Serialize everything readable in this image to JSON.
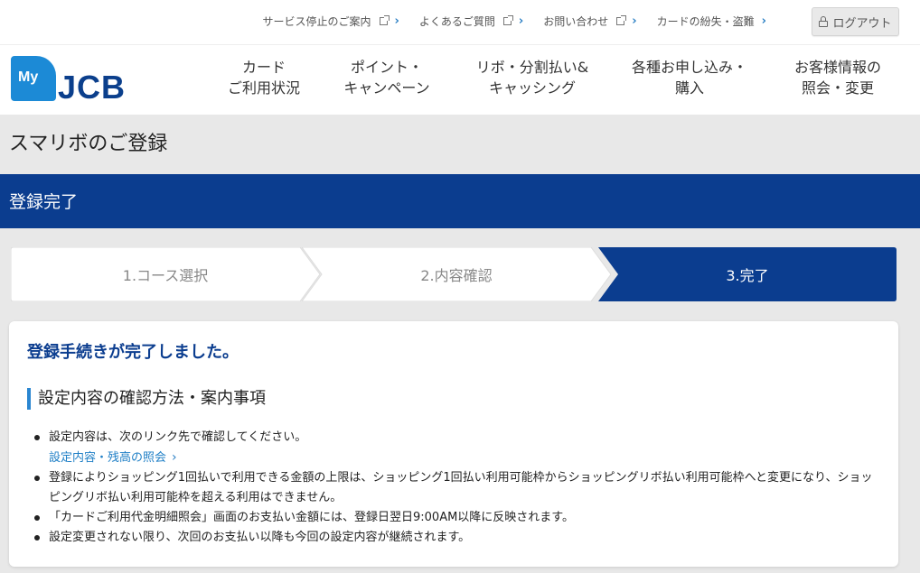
{
  "utility": {
    "links": [
      {
        "label": "サービス停止のご案内",
        "external": true
      },
      {
        "label": "よくあるご質問",
        "external": true
      },
      {
        "label": "お問い合わせ",
        "external": true
      },
      {
        "label": "カードの紛失・盗難",
        "external": false
      }
    ],
    "logout_label": "ログアウト"
  },
  "logo": {
    "my": "My",
    "brand": "JCB"
  },
  "nav": {
    "items": [
      {
        "label": "カード\nご利用状況"
      },
      {
        "label": "ポイント・\nキャンペーン"
      },
      {
        "label": "リボ・分割払い&\nキャッシング"
      },
      {
        "label": "各種お申し込み・\n購入"
      },
      {
        "label": "お客様情報の\n照会・変更"
      }
    ]
  },
  "page": {
    "title": "スマリボのご登録",
    "band_title": "登録完了"
  },
  "steps": [
    {
      "label": "1.コース選択",
      "active": false
    },
    {
      "label": "2.内容確認",
      "active": false
    },
    {
      "label": "3.完了",
      "active": true
    }
  ],
  "content": {
    "done_message": "登録手続きが完了しました。",
    "section_heading": "設定内容の確認方法・案内事項",
    "bullet1": "設定内容は、次のリンク先で確認してください。",
    "bullet1_link": "設定内容・残高の照会",
    "bullet2": "登録によりショッピング1回払いで利用できる金額の上限は、ショッピング1回払い利用可能枠からショッピングリボ払い利用可能枠へと変更になり、ショッピングリボ払い利用可能枠を超える利用はできません。",
    "bullet3": "「カードご利用代金明細照会」画面のお支払い金額には、登録日翌日9:00AM以降に反映されます。",
    "bullet4": "設定変更されない限り、次回のお支払い以降も今回の設定内容が継続されます。"
  },
  "colors": {
    "primary": "#0b3d8f",
    "accent": "#2a86d1",
    "link": "#1f7fc6"
  }
}
